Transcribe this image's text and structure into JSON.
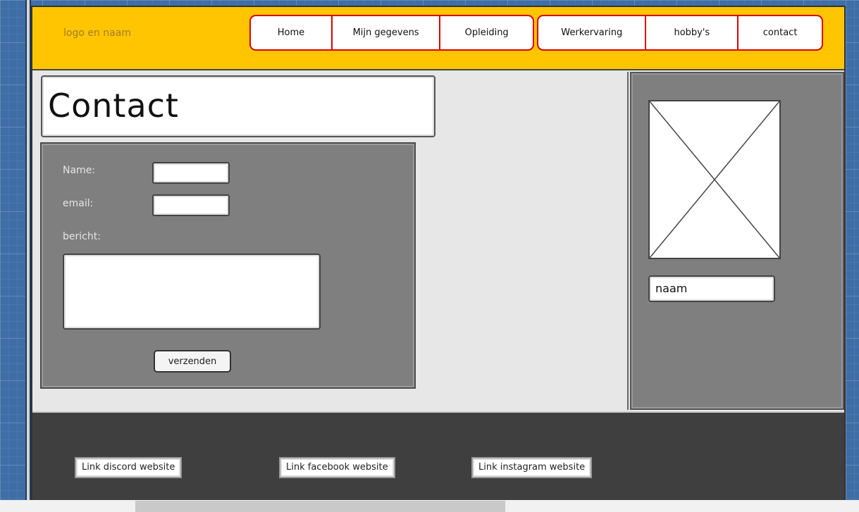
{
  "header": {
    "logo_text": "logo en naam",
    "nav_group_1": [
      "Home",
      "Mijn gegevens",
      "Opleiding"
    ],
    "nav_group_2": [
      "Werkervaring",
      "hobby's",
      "contact"
    ],
    "background_color": "#ffc500",
    "nav_border_color": "#e00000"
  },
  "main": {
    "page_title": "Contact",
    "form": {
      "name_label": "Name:",
      "name_value": "",
      "email_label": "email:",
      "email_value": "",
      "message_label": "bericht:",
      "message_value": "",
      "submit_label": "verzenden"
    }
  },
  "sidebar": {
    "image_icon": "image-placeholder-icon",
    "name_text": "naam"
  },
  "footer": {
    "links": [
      "Link discord website",
      "Link facebook website",
      "Link instagram website"
    ]
  }
}
